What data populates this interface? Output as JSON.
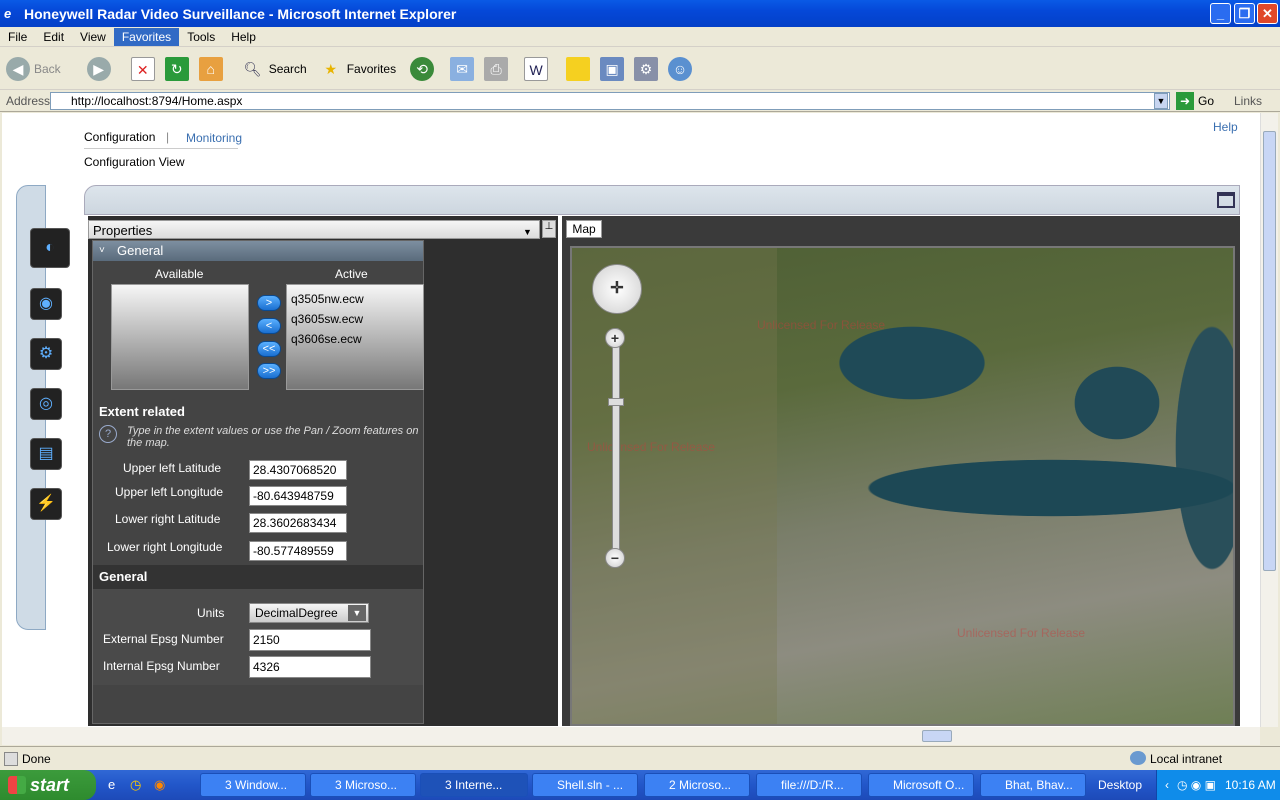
{
  "window": {
    "title": "Honeywell Radar Video Surveillance - Microsoft Internet Explorer"
  },
  "menu": [
    "File",
    "Edit",
    "View",
    "Favorites",
    "Tools",
    "Help"
  ],
  "toolbar": {
    "back": "Back",
    "search": "Search",
    "favorites": "Favorites"
  },
  "address": {
    "label": "Address",
    "url": "http://localhost:8794/Home.aspx",
    "go": "Go",
    "links": "Links"
  },
  "app": {
    "nav": {
      "configuration": "Configuration",
      "separator": "|",
      "monitoring": "Monitoring",
      "view_title": "Configuration View",
      "help": "Help"
    },
    "properties": {
      "title": "Properties",
      "general_header": "General",
      "available_label": "Available",
      "active_label": "Active",
      "active_items": [
        "q3505nw.ecw",
        "q3605sw.ecw",
        "q3606se.ecw"
      ],
      "move_buttons": [
        ">",
        "<",
        "<<",
        ">>"
      ],
      "extent": {
        "title": "Extent related",
        "hint": "Type in the extent values or use the Pan / Zoom features on the map.",
        "fields": [
          {
            "label": "Upper left Latitude",
            "value": "28.4307068520"
          },
          {
            "label": "Upper left Longitude",
            "value": "-80.643948759"
          },
          {
            "label": "Lower right Latitude",
            "value": "28.3602683434"
          },
          {
            "label": "Lower right Longitude",
            "value": "-80.577489559"
          }
        ]
      },
      "general2": {
        "title": "General",
        "units_label": "Units",
        "units_value": "DecimalDegree",
        "ext_label": "External Epsg Number",
        "ext_value": "2150",
        "int_label": "Internal Epsg Number",
        "int_value": "4326"
      }
    },
    "map": {
      "tab": "Map",
      "watermark": "Unlicensed For Release"
    }
  },
  "status": {
    "text": "Done",
    "zone": "Local intranet"
  },
  "taskbar": {
    "start": "start",
    "tasks": [
      "3 Window...",
      "3 Microso...",
      "3 Interne...",
      "Shell.sln - ...",
      "2 Microso...",
      "file:///D:/R...",
      "Microsoft O...",
      "Bhat, Bhav..."
    ],
    "desktop": "Desktop",
    "clock": "10:16 AM"
  }
}
